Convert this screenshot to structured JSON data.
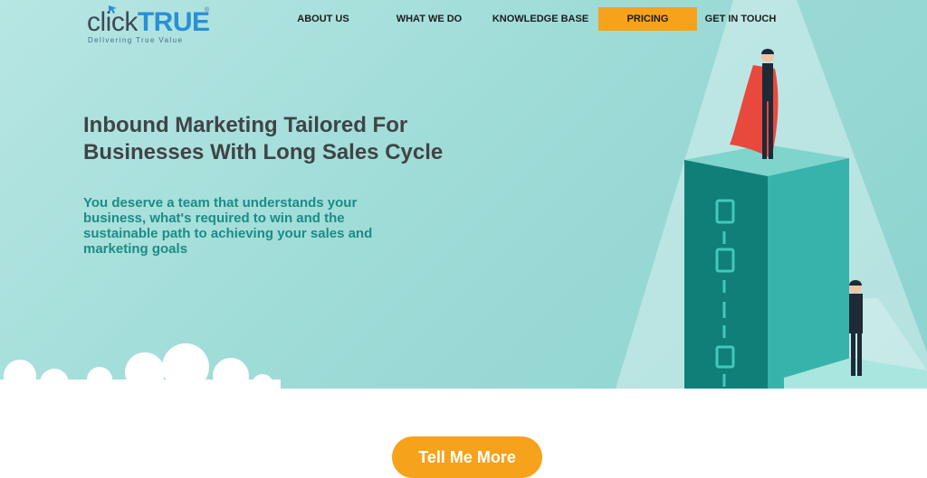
{
  "logo": {
    "brand_prefix": "click",
    "brand_suffix": "TRUE",
    "tagline": "Delivering True Value",
    "registered": "®"
  },
  "nav": {
    "items": [
      {
        "label": "ABOUT US"
      },
      {
        "label": "WHAT WE DO"
      },
      {
        "label": "KNOWLEDGE BASE"
      },
      {
        "label": "PRICING",
        "highlighted": true
      },
      {
        "label": "GET IN TOUCH"
      }
    ]
  },
  "hero": {
    "headline": "Inbound Marketing Tailored For Businesses With Long Sales Cycle",
    "subtext": "You deserve a team that understands your business, what's required to win and the sustainable path to achieving your sales and marketing goals"
  },
  "cta": {
    "label": "Tell Me More"
  },
  "colors": {
    "accent": "#f7a21b",
    "brand_blue": "#2a8fd6",
    "teal_text": "#1b8c87",
    "heading": "#3f4447",
    "hero_bg": "#9fdcd8"
  }
}
